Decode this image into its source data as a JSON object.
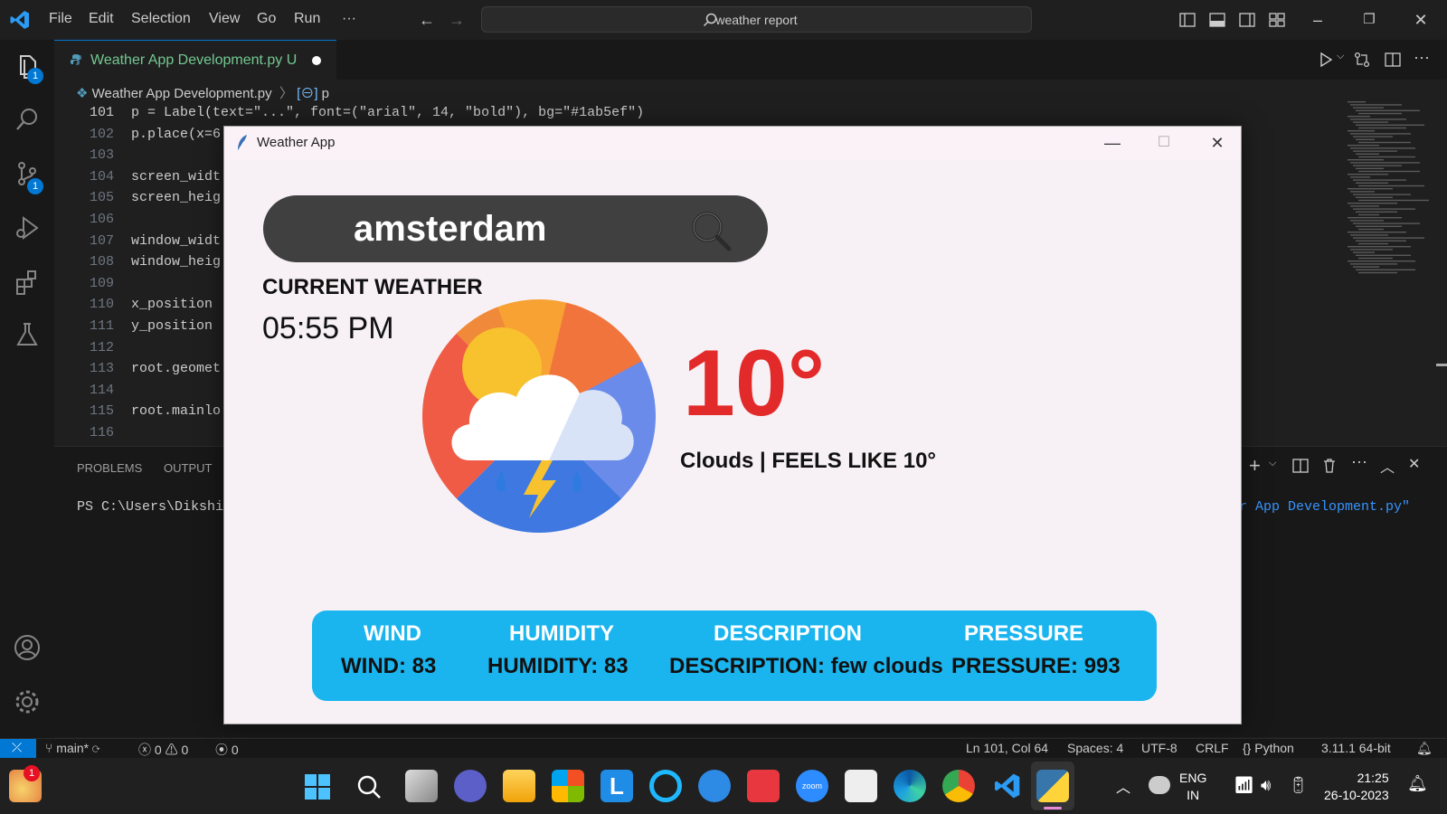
{
  "titlebar": {
    "menus": [
      "File",
      "Edit",
      "Selection",
      "View",
      "Go",
      "Run",
      "···"
    ],
    "search_text": "weather report"
  },
  "activity": {
    "explorer_badge": "1",
    "scm_badge": "1"
  },
  "editor": {
    "tab_label": "Weather App Development.py",
    "tab_status": "U",
    "breadcrumb_file": "Weather App Development.py",
    "breadcrumb_symbol": "p",
    "lines": [
      {
        "n": "101",
        "code": "p = Label(text=\"...\", font=(\"arial\", 14, \"bold\"), bg=\"#1ab5ef\")"
      },
      {
        "n": "102",
        "code": "p.place(x=6"
      },
      {
        "n": "103",
        "code": ""
      },
      {
        "n": "104",
        "code": "screen_widt"
      },
      {
        "n": "105",
        "code": "screen_heig"
      },
      {
        "n": "106",
        "code": ""
      },
      {
        "n": "107",
        "code": "window_widt"
      },
      {
        "n": "108",
        "code": "window_heig"
      },
      {
        "n": "109",
        "code": ""
      },
      {
        "n": "110",
        "code": "x_position"
      },
      {
        "n": "111",
        "code": "y_position"
      },
      {
        "n": "112",
        "code": ""
      },
      {
        "n": "113",
        "code": "root.geomet"
      },
      {
        "n": "114",
        "code": ""
      },
      {
        "n": "115",
        "code": "root.mainlo"
      },
      {
        "n": "116",
        "code": ""
      }
    ]
  },
  "panel": {
    "tabs": [
      "PROBLEMS",
      "OUTPUT"
    ],
    "terminal_prompt": "PS C:\\Users\\Dikshi",
    "terminal_tail": "r App Development.py\""
  },
  "statusbar": {
    "branch": "main*",
    "errors": "0",
    "warnings": "0",
    "ports": "0",
    "position": "Ln 101, Col 64",
    "spaces": "Spaces: 4",
    "encoding": "UTF-8",
    "eol": "CRLF",
    "language": "Python",
    "interpreter": "3.11.1 64-bit"
  },
  "weather_app": {
    "window_title": "Weather App",
    "city": "amsterdam",
    "current_weather_label": "CURRENT WEATHER",
    "time": "05:55 PM",
    "temperature": "10°",
    "feels_like": "Clouds | FEELS LIKE 10°",
    "info_headers": [
      "WIND",
      "HUMIDITY",
      "DESCRIPTION",
      "PRESSURE"
    ],
    "info_values": [
      "WIND: 83",
      "HUMIDITY: 83",
      "DESCRIPTION: few clouds",
      "PRESSURE: 993"
    ],
    "info_color": "#1ab5ef"
  },
  "taskbar": {
    "lang_line1": "ENG",
    "lang_line2": "IN",
    "time": "21:25",
    "date": "26-10-2023",
    "widget_badge": "1"
  }
}
